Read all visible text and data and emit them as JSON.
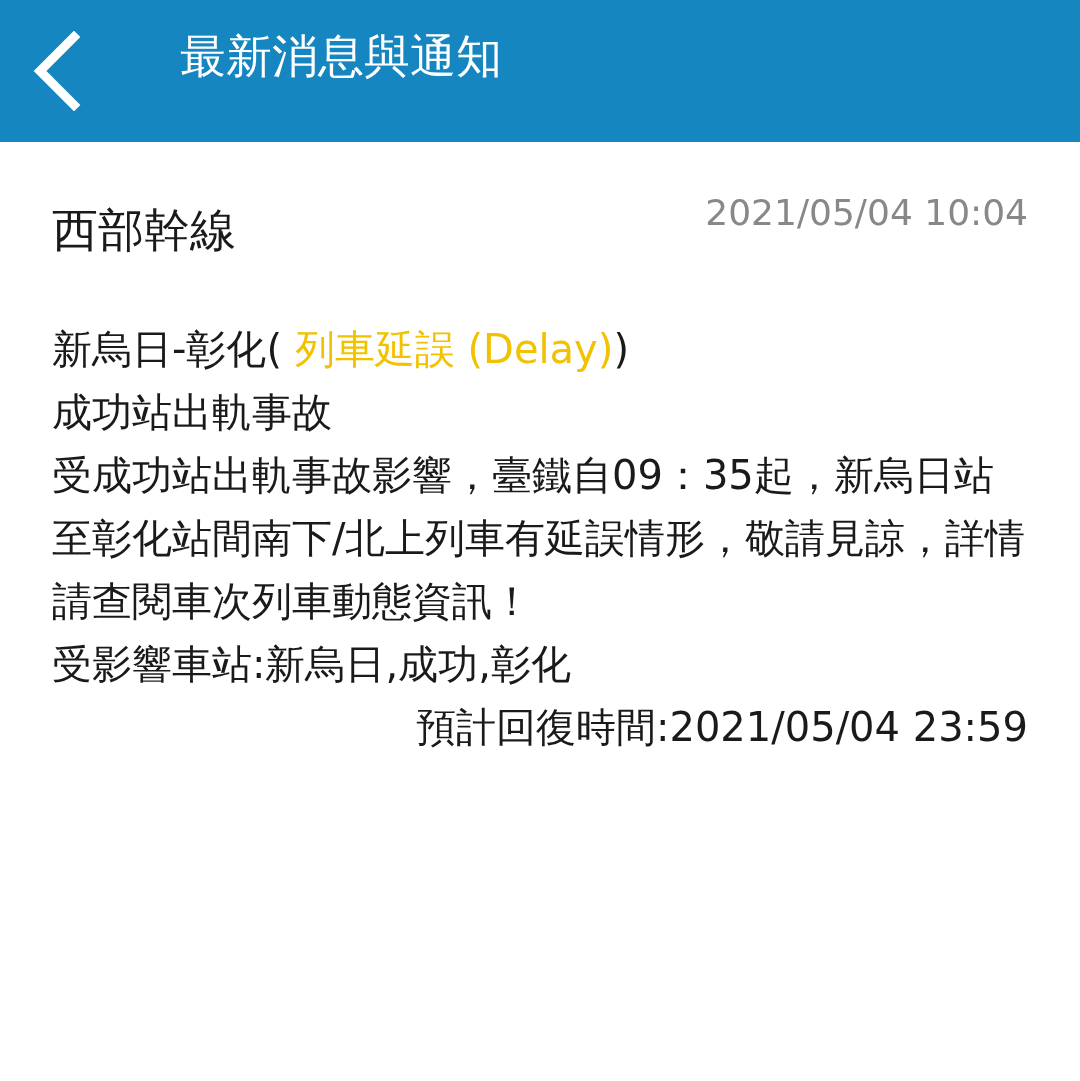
{
  "header": {
    "title": "最新消息與通知"
  },
  "notice": {
    "line": "西部幹線",
    "time": "2021/05/04 10:04",
    "section": {
      "prefix": "新烏日-彰化(",
      "status": " 列車延誤 (Delay)",
      "suffix": ")"
    },
    "headline": "成功站出軌事故",
    "body": "受成功站出軌事故影響，臺鐵自09：35起，新烏日站至彰化站間南下/北上列車有延誤情形，敬請見諒，詳情請查閱車次列車動態資訊！",
    "affected": "受影響車站:新烏日,成功,彰化",
    "recovery": "預計回復時間:2021/05/04 23:59"
  }
}
